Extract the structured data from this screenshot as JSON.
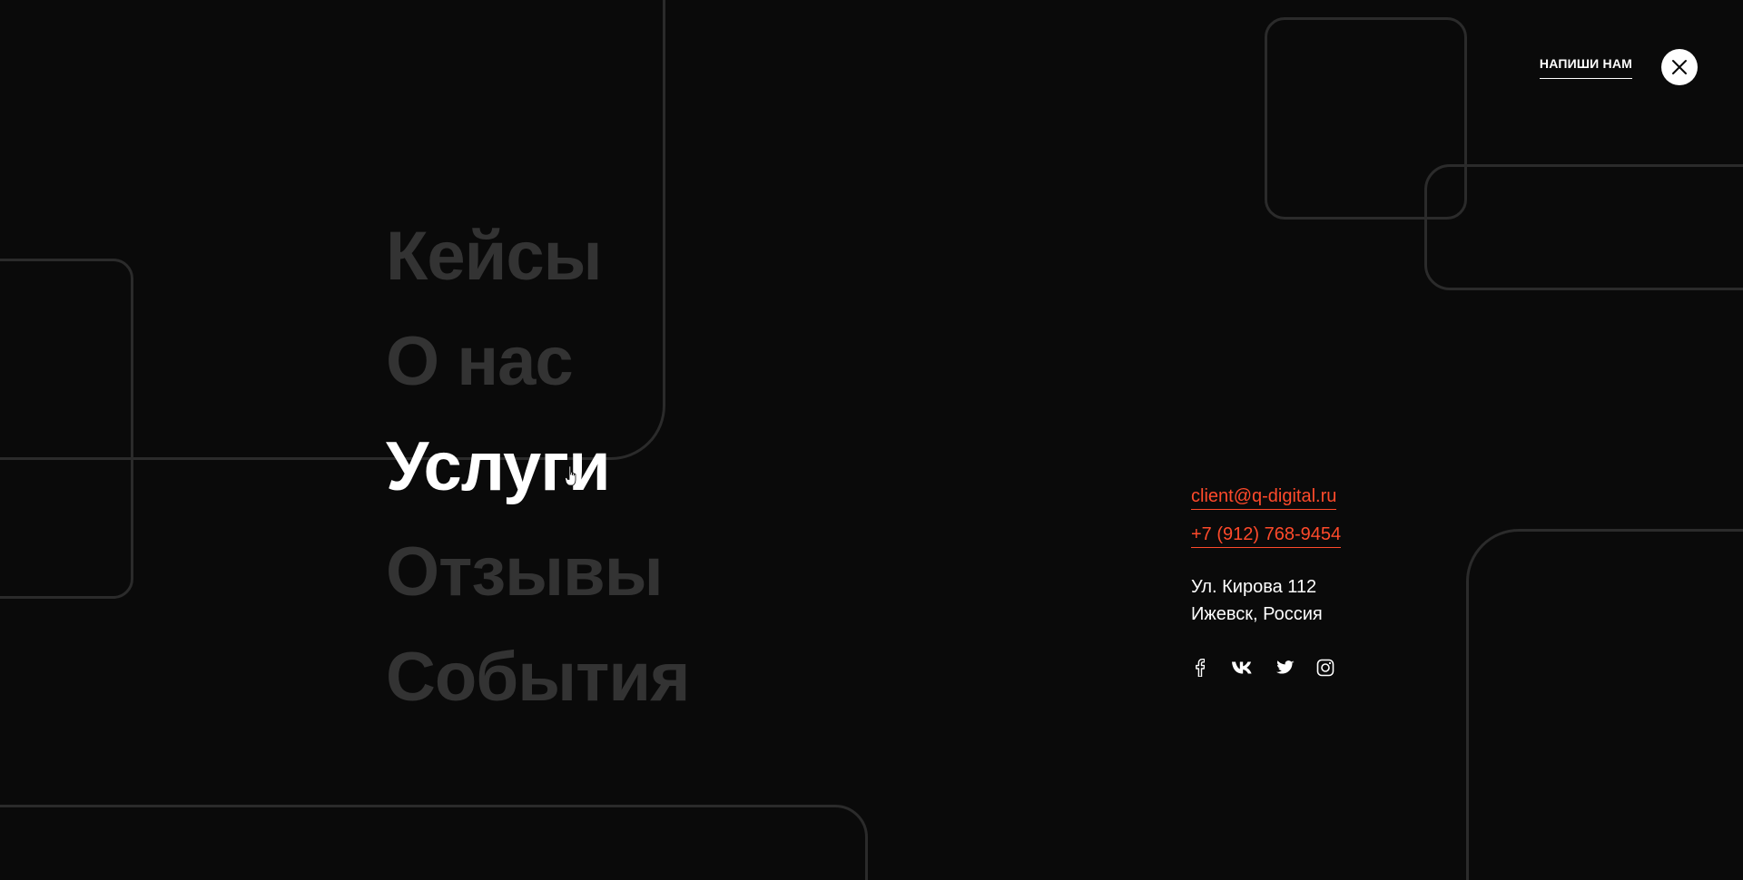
{
  "header": {
    "cta_label": "НАПИШИ НАМ",
    "close_icon": "close-icon"
  },
  "menu": {
    "items": [
      {
        "label": "Кейсы",
        "active": false
      },
      {
        "label": "О нас",
        "active": false
      },
      {
        "label": "Услуги",
        "active": true
      },
      {
        "label": "Отзывы",
        "active": false
      },
      {
        "label": "События",
        "active": false
      }
    ]
  },
  "contacts": {
    "email": "client@q-digital.ru",
    "phone": "+7 (912) 768-9454",
    "address_line1": "Ул. Кирова 112",
    "address_line2": "Ижевск, Россия",
    "socials": [
      "facebook-icon",
      "vk-icon",
      "twitter-icon",
      "instagram-icon"
    ]
  },
  "colors": {
    "background": "#0a0a0a",
    "accent": "#ff4a2b",
    "inactive_menu": "#333333",
    "frame": "#2b2b2b",
    "text": "#ffffff"
  }
}
